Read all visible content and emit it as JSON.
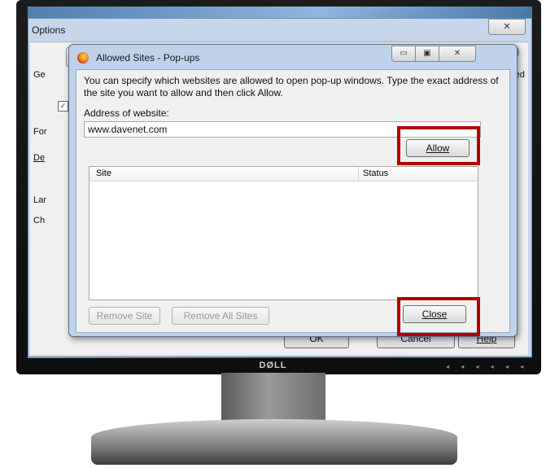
{
  "options_window": {
    "title": "Options",
    "close_glyph": "✕",
    "peek": {
      "tab_left": "Ge",
      "tab_right": "nced",
      "check": "✓",
      "fonts": "For",
      "default": "De",
      "languages": "Lar",
      "choose": "Ch",
      "ellipsis": "...",
      "ok_label": "OK",
      "cancel_label": "Cancel",
      "help_label": "Help"
    }
  },
  "dialog": {
    "title": "Allowed Sites - Pop-ups",
    "minimize_glyph": "▭",
    "maximize_glyph": "▣",
    "close_glyph": "✕",
    "description": "You can specify which websites are allowed to open pop-up windows. Type the exact address of the site you want to allow and then click Allow.",
    "address_label": "Address of website:",
    "address_value": "www.davenet.com",
    "allow_label": "Allow",
    "columns": [
      "Site",
      "Status"
    ],
    "rows": [],
    "remove_site_label": "Remove Site",
    "remove_all_label": "Remove All Sites",
    "close_label": "Close"
  },
  "monitor": {
    "brand": "DØLL",
    "status_leds": "◂ ◂ ◂ ◂ ◂ ◂"
  },
  "colors": {
    "highlight": "#b00000",
    "dialog_frame": "#bfd2ea"
  }
}
